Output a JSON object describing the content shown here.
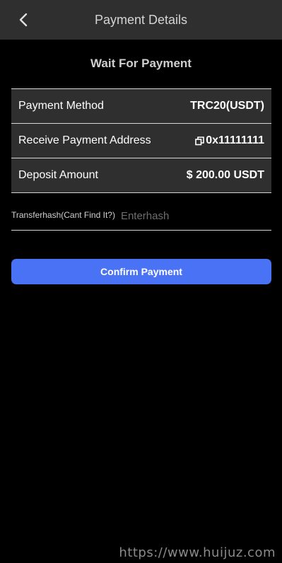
{
  "header": {
    "title": "Payment Details",
    "back_icon": "chevron-left-icon"
  },
  "page_title": "Wait For Payment",
  "details": [
    {
      "label": "Payment Method",
      "value": "TRC20(USDT)"
    },
    {
      "label": "Receive Payment Address",
      "value": "0x11111111",
      "icon": "copy-icon"
    },
    {
      "label": "Deposit Amount",
      "value": "$ 200.00 USDT"
    }
  ],
  "hash": {
    "label": "Transferhash(Cant Find It?)",
    "placeholder": "Enterhash",
    "value": ""
  },
  "confirm_label": "Confirm Payment",
  "watermark": "https://www.huijuz.com",
  "colors": {
    "background": "#000000",
    "panel": "#2f2f2f",
    "accent": "#4a72f5",
    "divider": "#d6d6d6"
  }
}
